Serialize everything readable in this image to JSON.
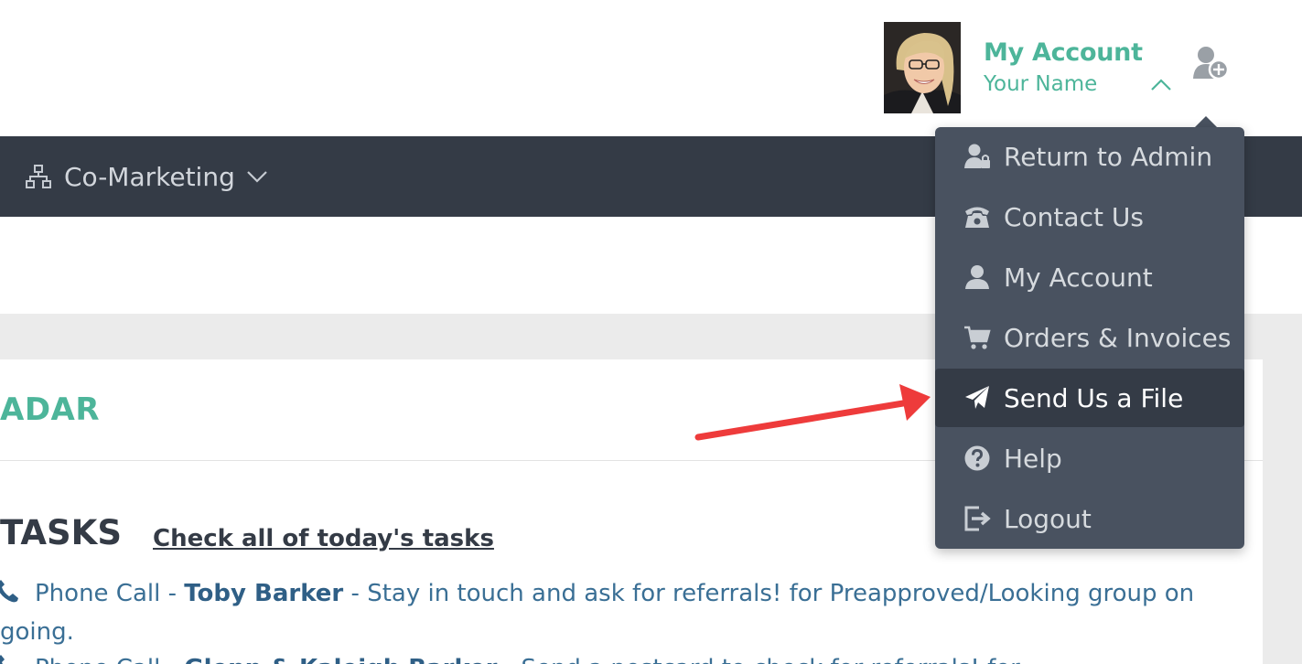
{
  "header": {
    "account_title": "My Account",
    "account_name": "Your Name"
  },
  "nav": {
    "items": [
      {
        "label": "Co-Marketing",
        "icon": "sitemap-icon"
      }
    ]
  },
  "dropdown": {
    "items": [
      {
        "label": "Return to Admin",
        "icon": "user-lock-icon",
        "active": false
      },
      {
        "label": "Contact Us",
        "icon": "phone-icon",
        "active": false
      },
      {
        "label": "My Account",
        "icon": "user-icon",
        "active": false
      },
      {
        "label": "Orders & Invoices",
        "icon": "cart-icon",
        "active": false
      },
      {
        "label": "Send Us a File",
        "icon": "paper-plane-icon",
        "active": true
      },
      {
        "label": "Help",
        "icon": "question-circle-icon",
        "active": false
      },
      {
        "label": "Logout",
        "icon": "logout-icon",
        "active": false
      }
    ]
  },
  "main": {
    "section_title": "ADAR",
    "tasks_heading": "TASKS",
    "tasks_link": "Check all of today's tasks",
    "tasks": [
      {
        "type": "Phone Call",
        "sep1": " - ",
        "contact": "Toby Barker",
        "sep2": " - ",
        "text": "Stay in touch and ask for referrals! for Preapproved/Looking group on going."
      },
      {
        "type": "Phone Call",
        "sep1": " - ",
        "contact": "Glenn & Kaleigh Barker",
        "sep2": " - ",
        "text": "Send a postcard to check for referrals! for"
      }
    ]
  },
  "colors": {
    "brand_green": "#4db59a",
    "navbar": "#343b46",
    "dropdown": "#495260",
    "arrow": "#ee3b3b"
  }
}
